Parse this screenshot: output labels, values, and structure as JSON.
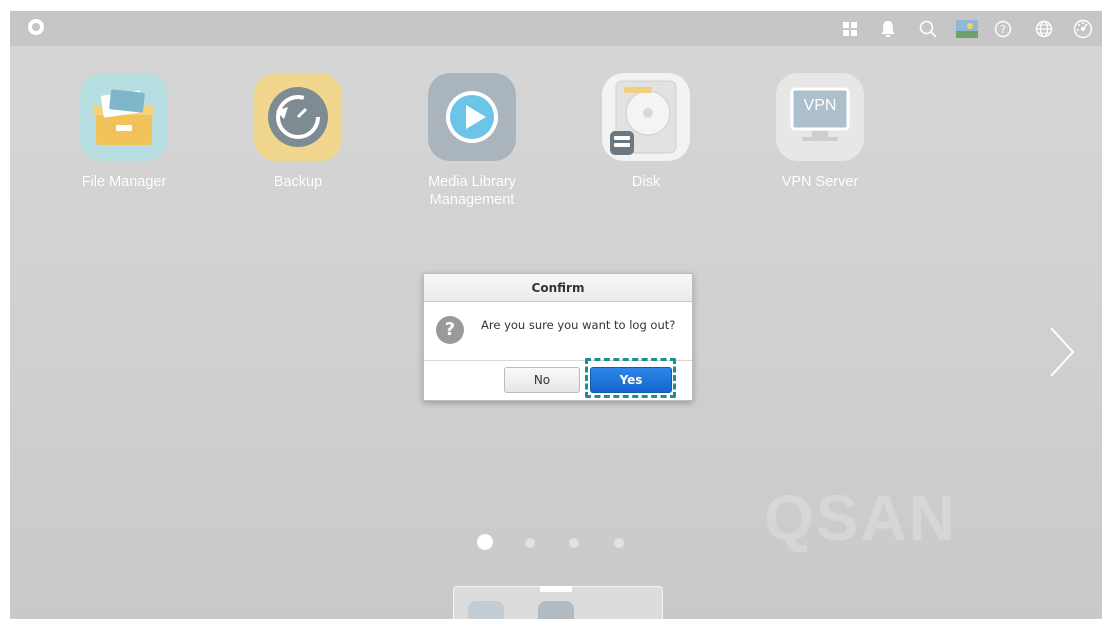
{
  "topbar": {
    "icons": [
      "logo-icon",
      "apps-grid-icon",
      "bell-icon",
      "search-icon",
      "weather-icon",
      "help-icon",
      "globe-icon",
      "dashboard-icon"
    ]
  },
  "apps": [
    {
      "label": "File Manager",
      "icon": "file-manager-icon"
    },
    {
      "label": "Backup",
      "icon": "backup-icon"
    },
    {
      "label": "Media Library\nManagement",
      "icon": "media-library-icon"
    },
    {
      "label": "Disk",
      "icon": "disk-icon"
    },
    {
      "label": "VPN Server",
      "icon": "vpn-icon",
      "icon_text": "VPN"
    }
  ],
  "watermark": "QSAN",
  "pagination": {
    "pages": 4,
    "current": 1
  },
  "dialog": {
    "title": "Confirm",
    "message": "Are you sure you want to log out?",
    "question_glyph": "?",
    "no_label": "No",
    "yes_label": "Yes"
  },
  "colors": {
    "accent_blue": "#1a6fd6",
    "highlight_teal": "#1e8e8e",
    "backdrop": "#d0d0d0"
  }
}
